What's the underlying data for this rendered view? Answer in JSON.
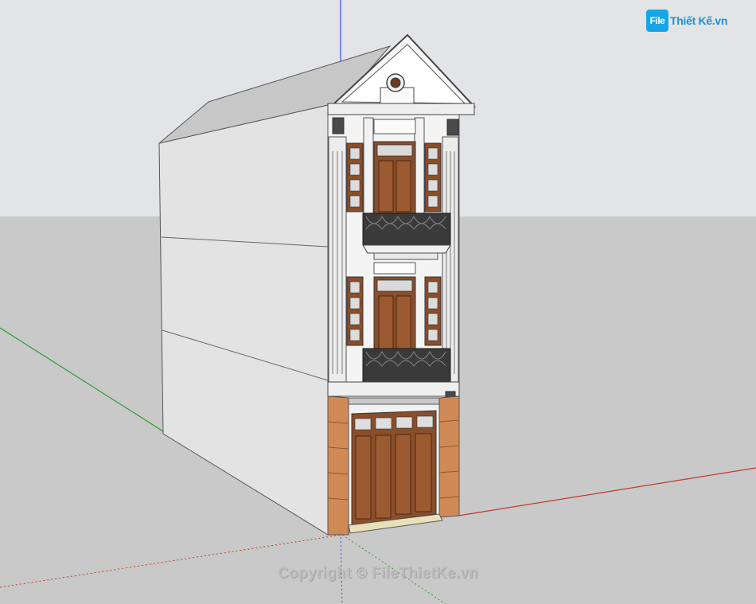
{
  "logo": {
    "badge_text": "File",
    "brand_text": "Thiết Kế",
    "brand_suffix": ".vn"
  },
  "watermark": {
    "text": "Copyright © FileThietKe.vn"
  },
  "colors": {
    "sky": "#e2e4e8",
    "ground": "#c8c8c8",
    "side_wall": "#dcdcdc",
    "front_wall": "#f4f4f4",
    "roof": "#c4c4c4",
    "brick": "#d08a55",
    "wood": "#8a4e2a",
    "railing": "#3a3a3a",
    "axis_red": "#c0392b",
    "axis_green": "#2ca02c",
    "axis_blue": "#3a4fd6",
    "logo_blue": "#16a6e6"
  },
  "model": {
    "subject": "3-storey townhouse facade"
  }
}
